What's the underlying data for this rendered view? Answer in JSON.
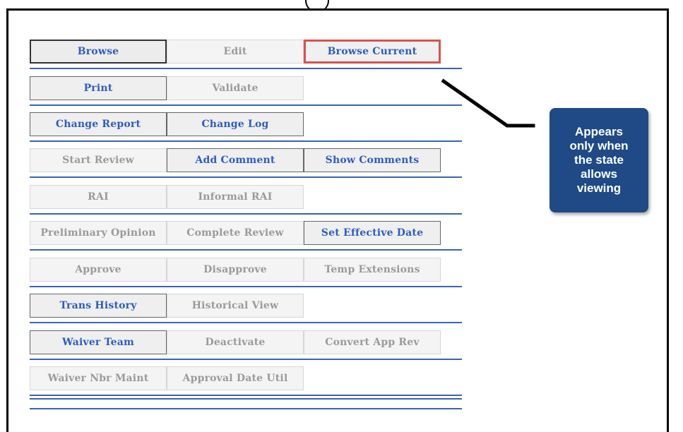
{
  "callout": {
    "text": "Appears\nonly when\nthe state\nallows\nviewing",
    "bg": "#1f4a85"
  },
  "colors": {
    "active_text": "#2e5cc0",
    "disabled_text": "#9a9a9a",
    "separator": "#3a64b4",
    "highlight": "#d9534f"
  },
  "rows": [
    [
      {
        "label": "Browse",
        "state": "active-strong"
      },
      {
        "label": "Edit",
        "state": "disabled"
      },
      {
        "label": "Browse Current",
        "state": "highlight"
      }
    ],
    [
      {
        "label": "Print",
        "state": "active"
      },
      {
        "label": "Validate",
        "state": "disabled"
      }
    ],
    [
      {
        "label": "Change Report",
        "state": "active"
      },
      {
        "label": "Change Log",
        "state": "active"
      }
    ],
    [
      {
        "label": "Start Review",
        "state": "disabled"
      },
      {
        "label": "Add Comment",
        "state": "active"
      },
      {
        "label": "Show Comments",
        "state": "active"
      }
    ],
    [
      {
        "label": "RAI",
        "state": "disabled"
      },
      {
        "label": "Informal RAI",
        "state": "disabled"
      }
    ],
    [
      {
        "label": "Preliminary Opinion",
        "state": "disabled"
      },
      {
        "label": "Complete Review",
        "state": "disabled"
      },
      {
        "label": "Set Effective Date",
        "state": "active"
      }
    ],
    [
      {
        "label": "Approve",
        "state": "disabled"
      },
      {
        "label": "Disapprove",
        "state": "disabled"
      },
      {
        "label": "Temp Extensions",
        "state": "disabled"
      }
    ],
    [
      {
        "label": "Trans History",
        "state": "active"
      },
      {
        "label": "Historical View",
        "state": "disabled"
      }
    ],
    [
      {
        "label": "Waiver Team",
        "state": "active"
      },
      {
        "label": "Deactivate",
        "state": "disabled"
      },
      {
        "label": "Convert App Rev",
        "state": "disabled"
      }
    ],
    [
      {
        "label": "Waiver Nbr Maint",
        "state": "disabled"
      },
      {
        "label": "Approval Date Util",
        "state": "disabled"
      }
    ]
  ]
}
